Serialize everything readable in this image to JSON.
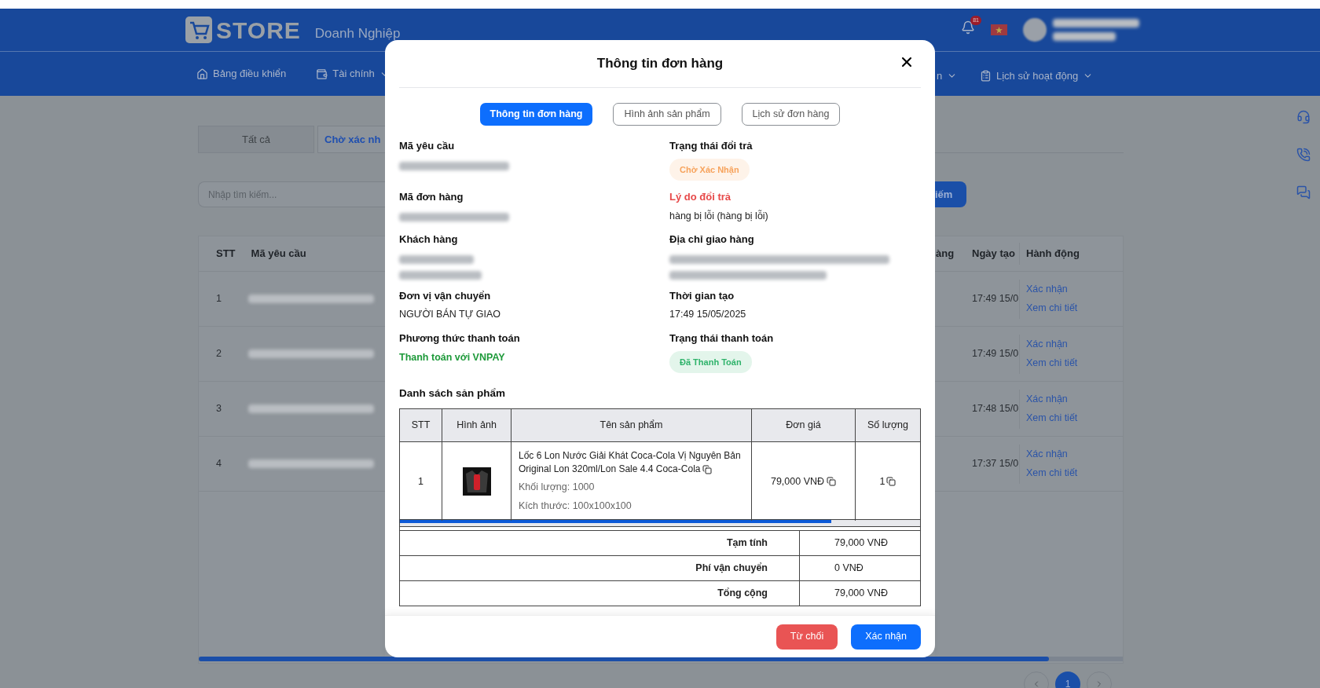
{
  "header": {
    "logo": "STORE",
    "subtitle": "Doanh Nghiệp",
    "notification_count": "81"
  },
  "nav": [
    {
      "label": "Bảng điều khiển",
      "dropdown": false
    },
    {
      "label": "Tài chính",
      "dropdown": true
    },
    {
      "label": "n",
      "dropdown": true
    },
    {
      "label": "Lịch sử hoạt động",
      "dropdown": true
    }
  ],
  "filter_tabs": [
    {
      "label": "Tất cả",
      "selected": false
    },
    {
      "label": "Chờ xác nh",
      "selected": true
    }
  ],
  "search": {
    "placeholder": "Nhập tìm kiếm...",
    "button": "iếm"
  },
  "table": {
    "columns_left": [
      "STT",
      "Mã yêu cầu"
    ],
    "columns_right": [
      "àng",
      "Ngày tạo",
      "Hành động"
    ],
    "rows": [
      {
        "stt": "1",
        "created": "17:49 15/0",
        "actions": [
          "Xác nhận",
          "Xem chi tiết"
        ]
      },
      {
        "stt": "2",
        "created": "17:49 15/0",
        "actions": [
          "Xác nhận",
          "Xem chi tiết"
        ]
      },
      {
        "stt": "3",
        "created": "17:48 15/0",
        "actions": [
          "Xác nhận",
          "Xem chi tiết"
        ]
      },
      {
        "stt": "4",
        "created": "17:37 15/0",
        "actions": [
          "Xác nhận",
          "Xem chi tiết"
        ]
      }
    ]
  },
  "pagination": [
    {
      "label": "1",
      "selected": true
    }
  ],
  "modal": {
    "title": "Thông tin đơn hàng",
    "tabs": [
      {
        "label": "Thông tin đơn hàng",
        "selected": true
      },
      {
        "label": "Hình ảnh sản phẩm",
        "selected": false
      },
      {
        "label": "Lịch sử đơn hàng",
        "selected": false
      }
    ],
    "rows": [
      [
        {
          "label": "Mã yêu cầu",
          "kind": "redacted"
        },
        {
          "label": "Trạng thái đổi trả",
          "kind": "badge",
          "value": "Chờ Xác Nhận",
          "color": "#f7a35c"
        }
      ],
      [
        {
          "label": "Mã đơn hàng",
          "kind": "redacted"
        },
        {
          "label": "Lý do đổi trả",
          "kind": "text",
          "value": "hàng bị lỗi (hàng bị lỗi)",
          "alert": true
        }
      ],
      [
        {
          "label": "Khách hàng",
          "kind": "redacted-multi"
        },
        {
          "label": "Địa chỉ giao hàng",
          "kind": "redacted-multi"
        }
      ],
      [
        {
          "label": "Đơn vị vận chuyển",
          "kind": "text",
          "value": "NGƯỜI BÁN TỰ GIAO"
        },
        {
          "label": "Thời gian tạo",
          "kind": "text",
          "value": "17:49 15/05/2025"
        }
      ],
      [
        {
          "label": "Phương thức thanh toán",
          "kind": "success",
          "value": "Thanh toán với VNPAY"
        },
        {
          "label": "Trạng thái thanh toán",
          "kind": "badge",
          "value": "Đã Thanh Toán",
          "color": "#2fb36b"
        }
      ]
    ],
    "products_title": "Danh sách sản phẩm",
    "product_columns": [
      "STT",
      "Hình ảnh",
      "Tên sản phẩm",
      "Đơn giá",
      "Số lượng"
    ],
    "products": [
      {
        "stt": "1",
        "name": "Lốc 6 Lon Nước Giải Khát Coca-Cola Vị Nguyên Bản Original Lon 320ml/Lon Sale 4.4 Coca-Cola",
        "weight": "Khối lượng: 1000",
        "size": "Kích thước: 100x100x100",
        "price": "79,000 VNĐ",
        "quantity": "1"
      }
    ],
    "summary": [
      {
        "label": "Tạm tính",
        "value": "79,000 VNĐ"
      },
      {
        "label": "Phí vận chuyển",
        "value": "0 VNĐ"
      },
      {
        "label": "Tổng cộng",
        "value": "79,000 VNĐ"
      }
    ],
    "buttons": [
      {
        "label": "Từ chối",
        "kind": "reject"
      },
      {
        "label": "Xác nhận",
        "kind": "confirm"
      }
    ]
  }
}
